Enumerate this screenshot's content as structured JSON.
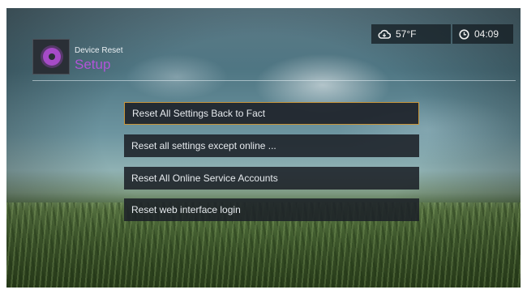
{
  "header": {
    "subtitle": "Device Reset",
    "title": "Setup",
    "icon": "gear-icon",
    "accent_color": "#b055d8"
  },
  "status": {
    "weather_icon": "cloud-icon",
    "temperature": "57°F",
    "clock_icon": "clock-icon",
    "time": "04:09"
  },
  "menu": {
    "items": [
      {
        "label": "Reset All Settings Back to Fact"
      },
      {
        "label": "Reset all settings except online ..."
      },
      {
        "label": "Reset All Online Service Accounts"
      },
      {
        "label": "Reset web interface login"
      }
    ],
    "selected_index": 0,
    "highlight_color": "#c8953a"
  }
}
